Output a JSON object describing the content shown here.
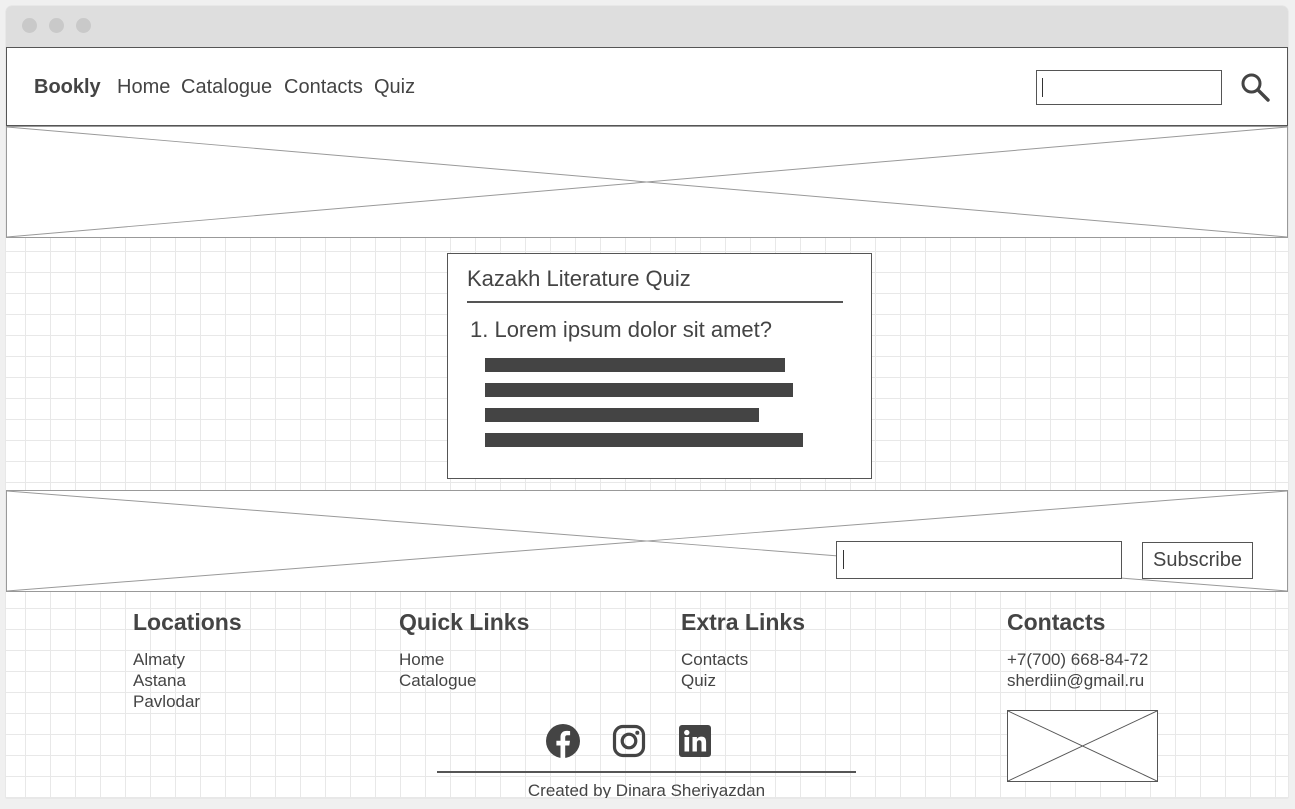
{
  "navbar": {
    "brand": "Bookly",
    "links": [
      "Home",
      "Catalogue",
      "Contacts",
      "Quiz"
    ],
    "search_value": "",
    "search_icon": "search-icon"
  },
  "quiz": {
    "title": "Kazakh Literature Quiz",
    "question": "1. Lorem ipsum dolor sit amet?",
    "answer_fill": "#444444"
  },
  "subscribe": {
    "input_value": "",
    "button_label": "Subscribe"
  },
  "footer": {
    "locations": {
      "heading": "Locations",
      "items": [
        "Almaty",
        "Astana",
        "Pavlodar"
      ]
    },
    "quick_links": {
      "heading": "Quick Links",
      "items": [
        "Home",
        "Catalogue"
      ]
    },
    "extra_links": {
      "heading": "Extra Links",
      "items": [
        "Contacts",
        "Quiz"
      ]
    },
    "contacts": {
      "heading": "Contacts",
      "phone": "+7(700) 668-84-72",
      "email": "sherdiin@gmail.ru"
    },
    "social_icons": [
      "facebook-icon",
      "instagram-icon",
      "linkedin-icon"
    ],
    "credit": "Created by Dinara Sheriyazdan"
  },
  "colors": {
    "text": "#444444",
    "border": "#555555",
    "grid": "#e8e8e8",
    "window_chrome": "#dedede"
  }
}
